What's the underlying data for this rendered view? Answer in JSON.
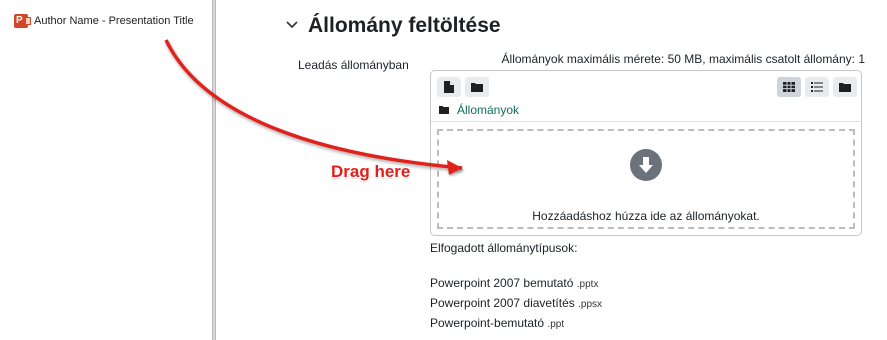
{
  "explorer": {
    "file_name": "Author Name - Presentation Title"
  },
  "section": {
    "collapse_icon": "chevron-down-icon",
    "title": "Állomány feltöltése"
  },
  "submission": {
    "label": "Leadás állományban",
    "limits": "Állományok maximális mérete: 50 MB, maximális csatolt állomány: 1"
  },
  "filepicker": {
    "toolbar_left": [
      "add-file-icon",
      "create-folder-icon"
    ],
    "toolbar_right": [
      "grid-view-icon",
      "list-view-icon",
      "tree-view-icon"
    ],
    "active_view": "grid-view-icon",
    "path_label": "Állományok",
    "drop_text": "Hozzáadáshoz húzza ide az állományokat.",
    "drop_icon": "download-arrow-icon"
  },
  "accepted": {
    "label": "Elfogadott állománytípusok:",
    "types": [
      {
        "name": "Powerpoint 2007 bemutató",
        "ext": ".pptx"
      },
      {
        "name": "Powerpoint 2007 diavetítés",
        "ext": ".ppsx"
      },
      {
        "name": "Powerpoint-bemutató",
        "ext": ".ppt"
      }
    ]
  },
  "annotation": {
    "text": "Drag here",
    "color": "#e0201c"
  }
}
